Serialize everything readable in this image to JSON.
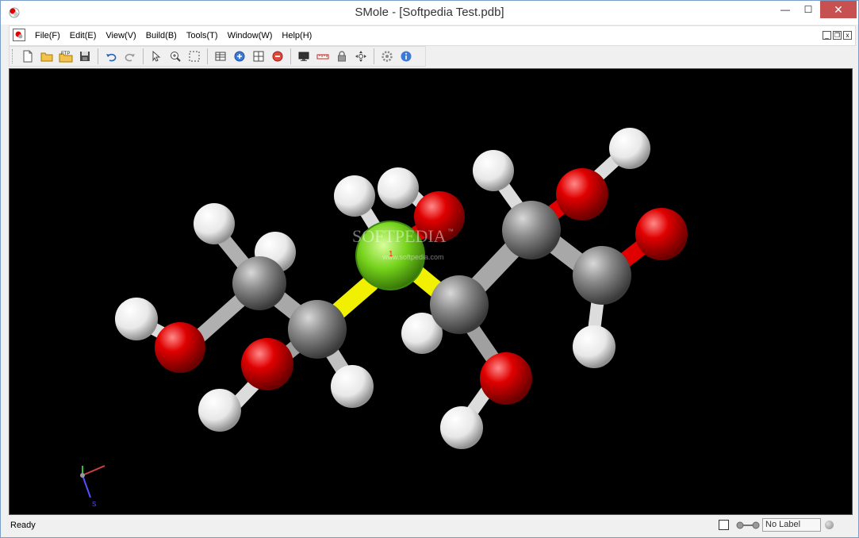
{
  "window": {
    "title": "SMole - [Softpedia Test.pdb]",
    "minimize_glyph": "—",
    "maximize_glyph": "☐",
    "close_glyph": "✕"
  },
  "menubar": {
    "items": [
      "File(F)",
      "Edit(E)",
      "View(V)",
      "Build(B)",
      "Tools(T)",
      "Window(W)",
      "Help(H)"
    ],
    "mdi_min": "_",
    "mdi_restore": "❐",
    "mdi_close": "x"
  },
  "toolbar": {
    "ftp_label": "FTP",
    "groups": [
      [
        "new-file-icon",
        "open-folder-icon",
        "ftp-open-icon",
        "save-icon"
      ],
      [
        "undo-icon",
        "redo-icon"
      ],
      [
        "select-arrow-icon",
        "zoom-icon",
        "rectangle-select-icon"
      ],
      [
        "table-icon",
        "add-circle-icon",
        "grid-icon",
        "remove-circle-icon"
      ],
      [
        "monitor-icon",
        "measure-icon",
        "lock-icon",
        "move-icon"
      ],
      [
        "settings-icon",
        "info-icon"
      ]
    ]
  },
  "viewport": {
    "watermark": "SOFTPEDIA",
    "watermark_tm": "™",
    "watermark_url": "www.softpedia.com",
    "selected_atom_label": "1",
    "axis_label": "S",
    "colors": {
      "carbon": "#808080",
      "oxygen": "#e00000",
      "hydrogen": "#f2f2f2",
      "sulfur_selected": "#7ed321",
      "bond_highlight": "#f0f000",
      "background": "#000000"
    }
  },
  "statusbar": {
    "status": "Ready",
    "label_field": "No Label"
  }
}
